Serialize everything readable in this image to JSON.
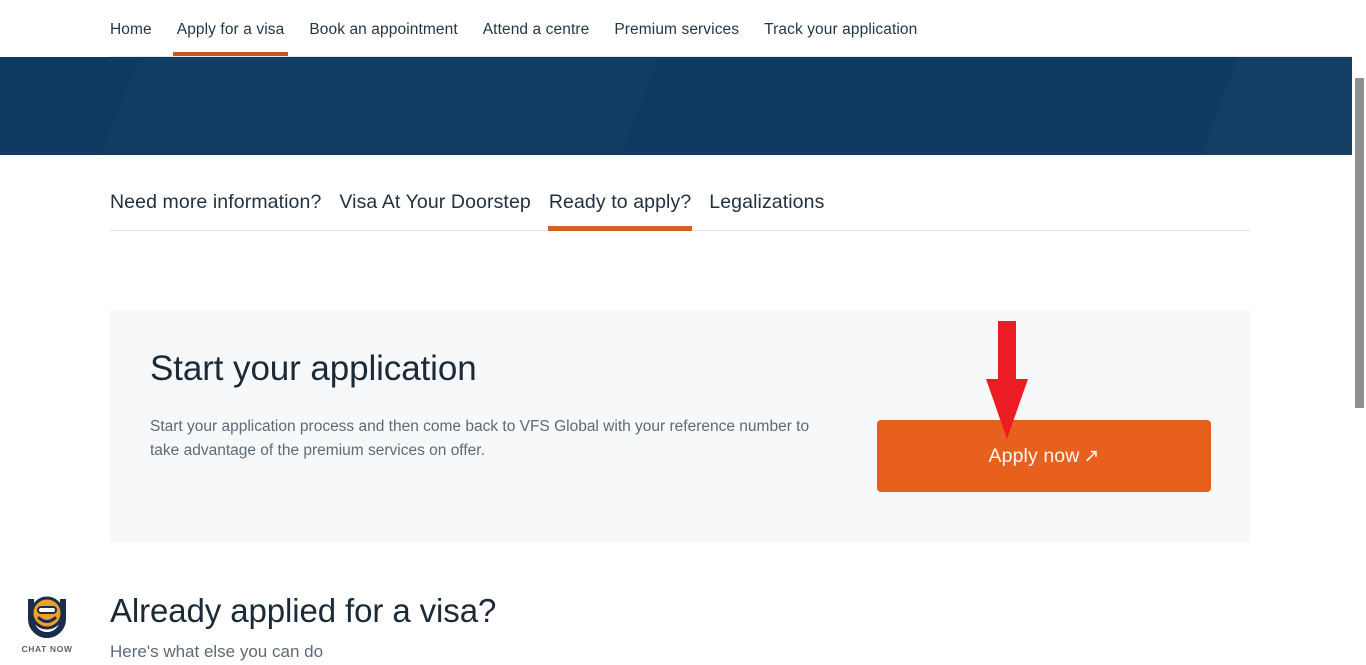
{
  "primary_nav": {
    "items": [
      {
        "label": "Home",
        "active": false
      },
      {
        "label": "Apply for a visa",
        "active": true
      },
      {
        "label": "Book an appointment",
        "active": false
      },
      {
        "label": "Attend a centre",
        "active": false
      },
      {
        "label": "Premium services",
        "active": false
      },
      {
        "label": "Track your application",
        "active": false
      }
    ]
  },
  "sub_nav": {
    "items": [
      {
        "label": "Need more information?",
        "active": false
      },
      {
        "label": "Visa At Your Doorstep",
        "active": false
      },
      {
        "label": "Ready to apply?",
        "active": true
      },
      {
        "label": "Legalizations",
        "active": false
      }
    ]
  },
  "start_application_card": {
    "title": "Start your application",
    "description": "Start your application process and then come back to VFS Global with your reference number to take advantage of the premium services on offer.",
    "apply_button_label": "Apply now",
    "apply_button_icon": "external-link-arrow",
    "apply_button_glyph": "↗"
  },
  "already_applied_section": {
    "title": "Already applied for a visa?",
    "subtitle": "Here's what else you can do"
  },
  "chat_widget": {
    "label": "CHAT NOW",
    "icon": "chat-bot-icon"
  },
  "annotation": {
    "type": "red-down-arrow",
    "points_to": "apply-now-button",
    "color": "#ec1c24"
  },
  "colors": {
    "hero_navy": "#0f3a61",
    "accent_orange": "#e8601e",
    "tab_underline_orange": "#cf6128",
    "nav_underline_orange": "#c05a2a",
    "card_background": "#f7f8fa",
    "annotation_red": "#ec1c24",
    "scrollbar_thumb": "#8d8f91"
  }
}
